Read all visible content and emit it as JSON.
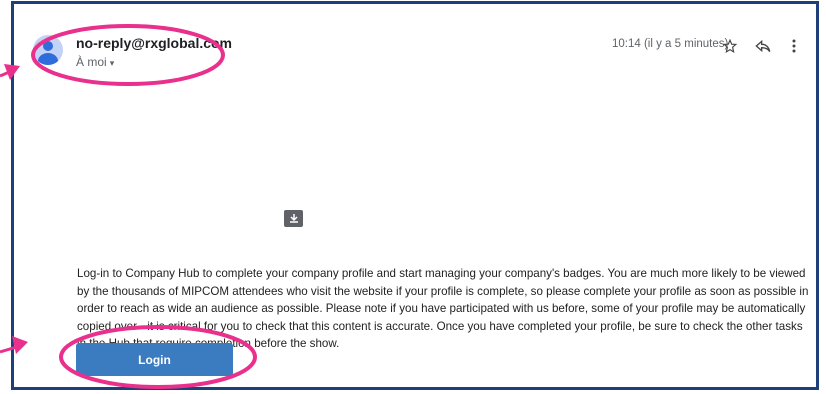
{
  "email": {
    "sender": "no-reply@rxglobal.com",
    "recipient": "À moi",
    "recipient_caret": "▾",
    "timestamp": "10:14 (il y a 5 minutes)",
    "icons": {
      "star": "star-icon",
      "reply": "reply-icon",
      "more": "more-vert-icon",
      "download": "download-icon",
      "avatar": "avatar-icon"
    },
    "body_text": "Log-in to Company Hub to complete your company profile and start managing your company's badges. You are much more likely to be viewed by the thousands of MIPCOM attendees who visit the website if your profile is complete, so please complete your profile as soon as possible in order to reach as wide an audience as possible. Please note if you have participated with us before, some of your profile may be automatically copied over - it is critical for you to check that this content is accurate. Once you have completed your profile, be sure to check the other tasks in the Hub that require completion before the show.",
    "login_label": "Login"
  },
  "annotation": {
    "color": "#e8308c"
  }
}
